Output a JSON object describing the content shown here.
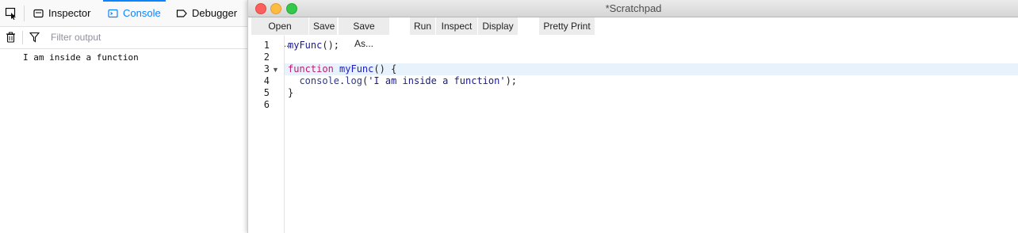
{
  "devtools": {
    "tabs": [
      {
        "label": "Inspector",
        "icon": "inspector-icon"
      },
      {
        "label": "Console",
        "icon": "console-icon",
        "active": true
      },
      {
        "label": "Debugger",
        "icon": "debugger-icon"
      }
    ],
    "filter": {
      "placeholder": "Filter output",
      "value": ""
    },
    "console_output": [
      "I am inside a function"
    ],
    "accent_color": "#0a84ff"
  },
  "scratchpad": {
    "title": "*Scratchpad",
    "toolbar": {
      "open_file": "Open File...",
      "save": "Save",
      "save_as": "Save As...",
      "run": "Run",
      "inspect": "Inspect",
      "display": "Display",
      "pretty_print": "Pretty Print"
    },
    "line_numbers": [
      "1",
      "2",
      "3",
      "4",
      "5",
      "6"
    ],
    "active_line": 3,
    "code_tokens": {
      "l1_call": "myFunc",
      "l1_rest": "();",
      "l3_keyword": "function",
      "l3_name": "myFunc",
      "l3_rest": "() {",
      "l4_indent": "  ",
      "l4_obj": "console",
      "l4_dot": ".",
      "l4_method": "log",
      "l4_open": "(",
      "l4_string": "'I am inside a function'",
      "l4_close": ");",
      "l5": "}"
    }
  }
}
